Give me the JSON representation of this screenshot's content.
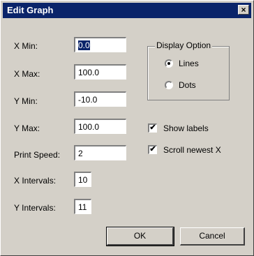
{
  "window": {
    "title": "Edit Graph",
    "close_glyph": "×"
  },
  "fields": {
    "x_min": {
      "label": "X Min:",
      "value": "0.0"
    },
    "x_max": {
      "label": "X Max:",
      "value": "100.0"
    },
    "y_min": {
      "label": "Y Min:",
      "value": "-10.0"
    },
    "y_max": {
      "label": "Y Max:",
      "value": "100.0"
    },
    "print_speed": {
      "label": "Print Speed:",
      "value": "2"
    },
    "x_intervals": {
      "label": "X Intervals:",
      "value": "10"
    },
    "y_intervals": {
      "label": "Y Intervals:",
      "value": "11"
    }
  },
  "display_option": {
    "title": "Display Option",
    "options": [
      {
        "label": "Lines",
        "selected": true
      },
      {
        "label": "Dots",
        "selected": false
      }
    ]
  },
  "checkboxes": {
    "show_labels": {
      "label": "Show labels",
      "checked": true,
      "mark": "✔"
    },
    "scroll_newest": {
      "label": "Scroll newest X",
      "checked": true,
      "mark": "✔"
    }
  },
  "buttons": {
    "ok": "OK",
    "cancel": "Cancel"
  },
  "colors": {
    "titlebar": "#0a246a",
    "dialog": "#d4d0c8",
    "selection": "#0a246a"
  }
}
